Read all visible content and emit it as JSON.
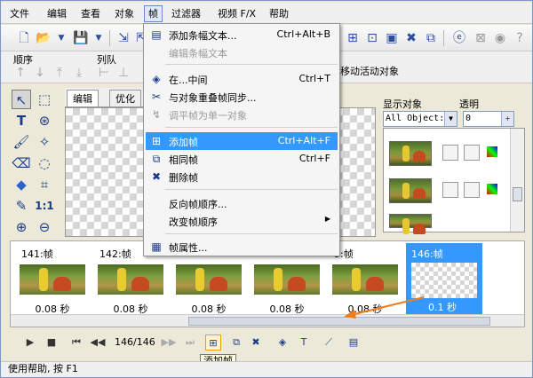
{
  "menubar": {
    "items": [
      "文件",
      "编辑",
      "查看",
      "对象",
      "帧",
      "过滤器",
      "视频 F/X",
      "帮助"
    ]
  },
  "row2": {
    "order_label": "顺序",
    "align_label": "列队",
    "move_label": "移动活动对象"
  },
  "canvas": {
    "tabs": [
      "编辑",
      "优化"
    ]
  },
  "right_panel": {
    "display_label": "显示对象",
    "opacity_label": "透明",
    "objects_combo": "All Object:",
    "opacity_value": "0"
  },
  "menu": {
    "items": [
      {
        "label": "添加条幅文本...",
        "shortcut": "Ctrl+Alt+B",
        "icon": "banner-text-icon",
        "disabled": false
      },
      {
        "label": "编辑条幅文本",
        "shortcut": "",
        "icon": "",
        "disabled": true
      },
      {
        "label": "在...中间",
        "shortcut": "Ctrl+T",
        "icon": "tween-icon",
        "disabled": false
      },
      {
        "label": "与对象重叠帧同步...",
        "shortcut": "",
        "icon": "sync-icon",
        "disabled": false
      },
      {
        "label": "调平帧为单一对象",
        "shortcut": "",
        "icon": "flatten-icon",
        "disabled": true
      },
      {
        "label": "添加帧",
        "shortcut": "Ctrl+Alt+F",
        "icon": "add-frame-icon",
        "disabled": false
      },
      {
        "label": "相同帧",
        "shortcut": "Ctrl+F",
        "icon": "duplicate-frame-icon",
        "disabled": false
      },
      {
        "label": "删除帧",
        "shortcut": "",
        "icon": "delete-frame-icon",
        "disabled": false
      },
      {
        "label": "反向帧顺序...",
        "shortcut": "",
        "icon": "",
        "disabled": false
      },
      {
        "label": "改变帧顺序",
        "shortcut": "",
        "icon": "",
        "disabled": false
      },
      {
        "label": "帧属性...",
        "shortcut": "",
        "icon": "frame-properties-icon",
        "disabled": false
      }
    ]
  },
  "frames": [
    {
      "label": "141:帧",
      "duration": "0.08 秒"
    },
    {
      "label": "142:帧",
      "duration": "0.08 秒"
    },
    {
      "label": "",
      "duration": "0.08 秒"
    },
    {
      "label": "",
      "duration": "0.08 秒"
    },
    {
      "label": "5:帧",
      "duration": "0.08 秒"
    },
    {
      "label": "146:帧",
      "duration": "0.1 秒"
    }
  ],
  "playbar": {
    "counter": "146/146",
    "tooltip": "添加帧"
  },
  "status": {
    "text": "使用帮助, 按 F1"
  },
  "colors": {
    "highlight": "#3399ff",
    "arrow": "#f07d1a"
  }
}
